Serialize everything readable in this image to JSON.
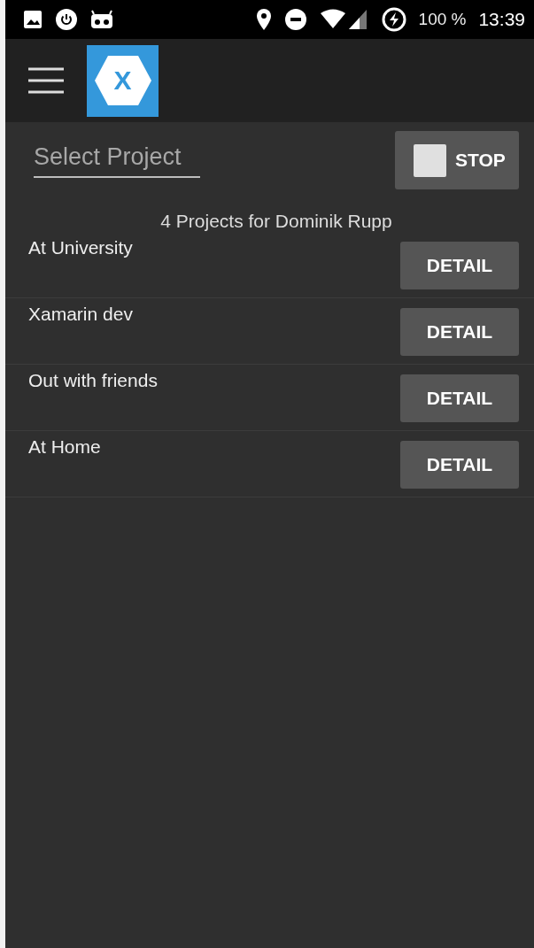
{
  "status_bar": {
    "battery": "100 %",
    "time": "13:39"
  },
  "toolbar": {
    "logo_letter": "X"
  },
  "project_picker": {
    "placeholder": "Select Project"
  },
  "stop_button": {
    "label": "STOP"
  },
  "projects_header": "4 Projects for Dominik Rupp",
  "projects": [
    {
      "name": "At University",
      "button": "DETAIL"
    },
    {
      "name": "Xamarin dev",
      "button": "DETAIL"
    },
    {
      "name": "Out with friends",
      "button": "DETAIL"
    },
    {
      "name": "At Home",
      "button": "DETAIL"
    }
  ]
}
